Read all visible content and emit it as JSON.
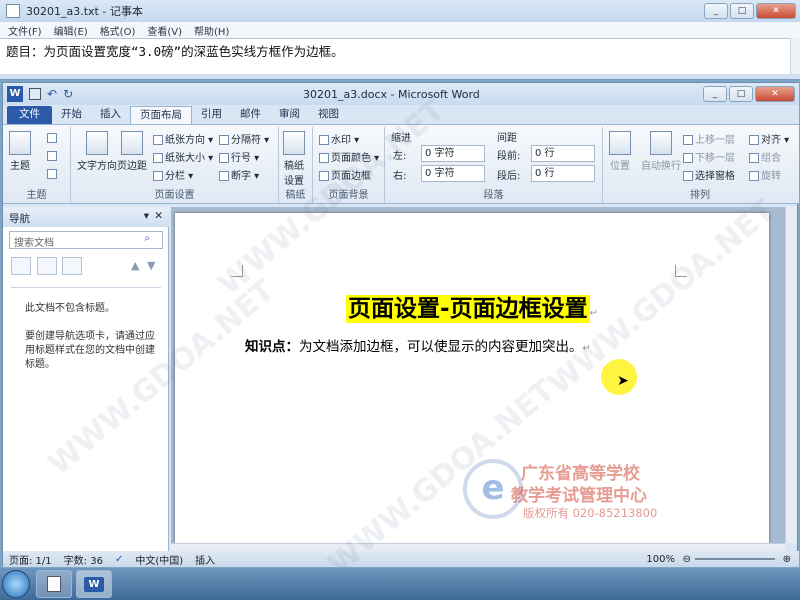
{
  "notepad": {
    "title": "30201_a3.txt - 记事本",
    "menu": [
      "文件(F)",
      "编辑(E)",
      "格式(O)",
      "查看(V)",
      "帮助(H)"
    ],
    "content": "题目：为页面设置宽度“3.0磅”的深蓝色实线方框作为边框。"
  },
  "word": {
    "title": "30201_a3.docx - Microsoft Word",
    "tabs": [
      "文件",
      "开始",
      "插入",
      "页面布局",
      "引用",
      "邮件",
      "审阅",
      "视图"
    ],
    "active_tab": "页面布局",
    "ribbon": {
      "theme_group": {
        "label": "主题",
        "button": "主题"
      },
      "page_setup": {
        "label": "页面设置",
        "text_direction": "文字方向",
        "margins": "页边距",
        "orientation": "纸张方向",
        "size": "纸张大小",
        "columns": "分栏",
        "breaks": "分隔符",
        "line_numbers": "行号",
        "hyphenation": "断字"
      },
      "manuscript": {
        "label": "稿纸",
        "button_line1": "稿纸",
        "button_line2": "设置"
      },
      "page_background": {
        "label": "页面背景",
        "watermark": "水印",
        "page_color": "页面颜色",
        "page_borders": "页面边框"
      },
      "paragraph": {
        "label": "段落",
        "indent_title": "缩进",
        "spacing_title": "间距",
        "left_label": "左:",
        "left_value": "0 字符",
        "right_label": "右:",
        "right_value": "0 字符",
        "before_label": "段前:",
        "before_value": "0 行",
        "after_label": "段后:",
        "after_value": "0 行"
      },
      "arrange": {
        "label": "排列",
        "position": "位置",
        "wrap": "自动换行",
        "bring_forward": "上移一层",
        "send_backward": "下移一层",
        "selection_pane": "选择窗格",
        "align": "对齐",
        "group": "组合",
        "rotate": "旋转"
      }
    },
    "nav": {
      "title": "导航",
      "search_placeholder": "搜索文档",
      "msg1": "此文档不包含标题。",
      "msg2": "要创建导航选项卡，请通过应用标题样式在您的文档中创建标题。"
    },
    "document": {
      "heading": "页面设置-页面边框设置",
      "kp_label": "知识点：",
      "kp_text": "为文档添加边框，可以使显示的内容更加突出。"
    },
    "status": {
      "page": "页面: 1/1",
      "words": "字数: 36",
      "language": "中文(中国)",
      "mode": "插入",
      "zoom": "100%"
    },
    "logo": {
      "line1": "广东省高等学校",
      "line2": "教学考试管理中心",
      "line3": "版权所有 020-85213800"
    },
    "colors": {
      "highlight": "#ffff00",
      "logo_red": "#d44a3a",
      "file_tab": "#2a5aa8"
    }
  },
  "watermark_text": "WWW.GDOA.NET",
  "taskbar": {
    "word_label": "W"
  }
}
